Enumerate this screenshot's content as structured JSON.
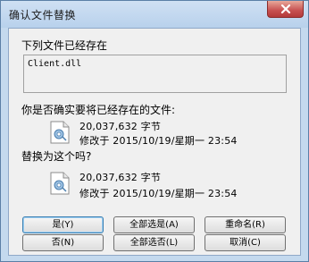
{
  "window": {
    "title": "确认文件替换"
  },
  "dialog": {
    "heading": "下列文件已经存在",
    "filename": "Client.dll",
    "question_existing": "你是否确实要将已经存在的文件:",
    "existing_size": "20,037,632 字节",
    "existing_modified": "修改于 2015/10/19/星期一 23:54",
    "question_replace": "替换为这个吗?",
    "new_size": "20,037,632 字节",
    "new_modified": "修改于 2015/10/19/星期一 23:54"
  },
  "buttons": {
    "yes": "是(Y)",
    "yes_all": "全部选是(A)",
    "rename": "重命名(R)",
    "no": "否(N)",
    "no_all": "全部选否(L)",
    "cancel": "取消(C)"
  },
  "icons": {
    "close": "close-icon",
    "file": "dll-file-icon"
  },
  "colors": {
    "frame": "#c4d9ee",
    "close_button": "#c75050",
    "client_bg": "#f0f0f0"
  }
}
